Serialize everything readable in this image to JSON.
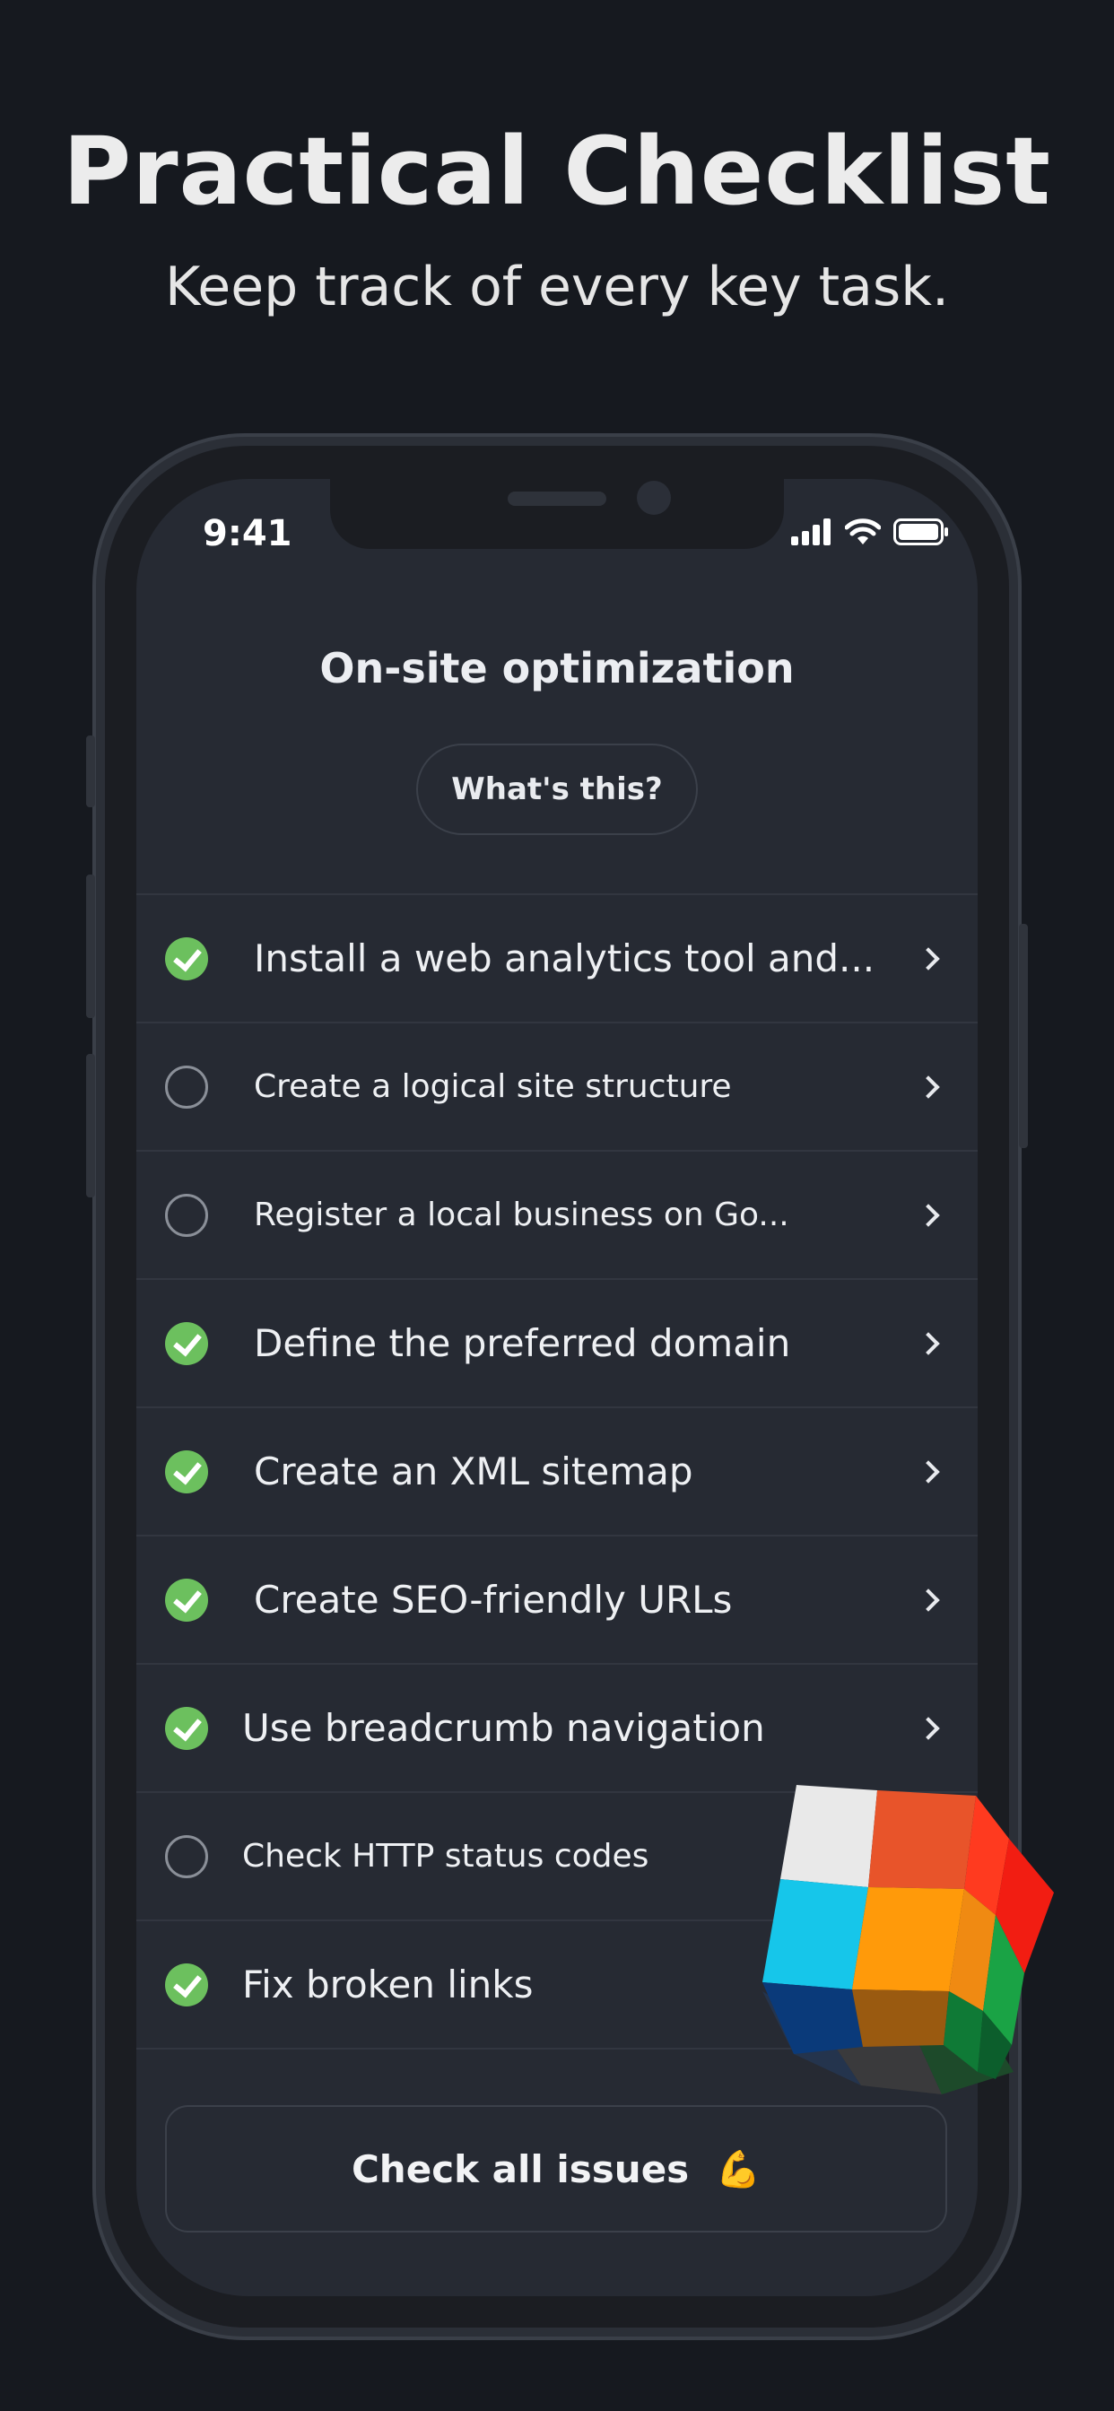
{
  "hero": {
    "title": "Practical Checklist",
    "subtitle": "Keep track of every key task."
  },
  "status_bar": {
    "time": "9:41"
  },
  "screen": {
    "title": "On-site optimization",
    "whats_this_label": "What's this?"
  },
  "checklist": [
    {
      "label": "Install a web analytics tool and...",
      "done": true,
      "chevron": true
    },
    {
      "label": "Create a logical site structure",
      "done": false,
      "chevron": true
    },
    {
      "label": "Register a local business on Go...",
      "done": false,
      "chevron": true
    },
    {
      "label": "Define the preferred domain",
      "done": true,
      "chevron": true
    },
    {
      "label": "Create an XML sitemap",
      "done": true,
      "chevron": true
    },
    {
      "label": "Create SEO-friendly URLs",
      "done": true,
      "chevron": true
    },
    {
      "label": "Use breadcrumb navigation",
      "done": true,
      "chevron": true
    },
    {
      "label": "Check HTTP status codes",
      "done": false,
      "chevron": false
    },
    {
      "label": "Fix broken links",
      "done": true,
      "chevron": false
    }
  ],
  "footer": {
    "check_all_label": "Check all issues",
    "check_all_emoji": "💪"
  },
  "icons": {
    "signal": "cellular-signal-icon",
    "wifi": "wifi-icon",
    "battery": "battery-icon",
    "done": "checkmark-circle-icon",
    "todo": "empty-circle-icon",
    "chevron": "chevron-right-icon",
    "decor": "colored-cube-illustration"
  },
  "colors": {
    "background": "#16191f",
    "screen": "#262a33",
    "done_green": "#6cc05e"
  }
}
